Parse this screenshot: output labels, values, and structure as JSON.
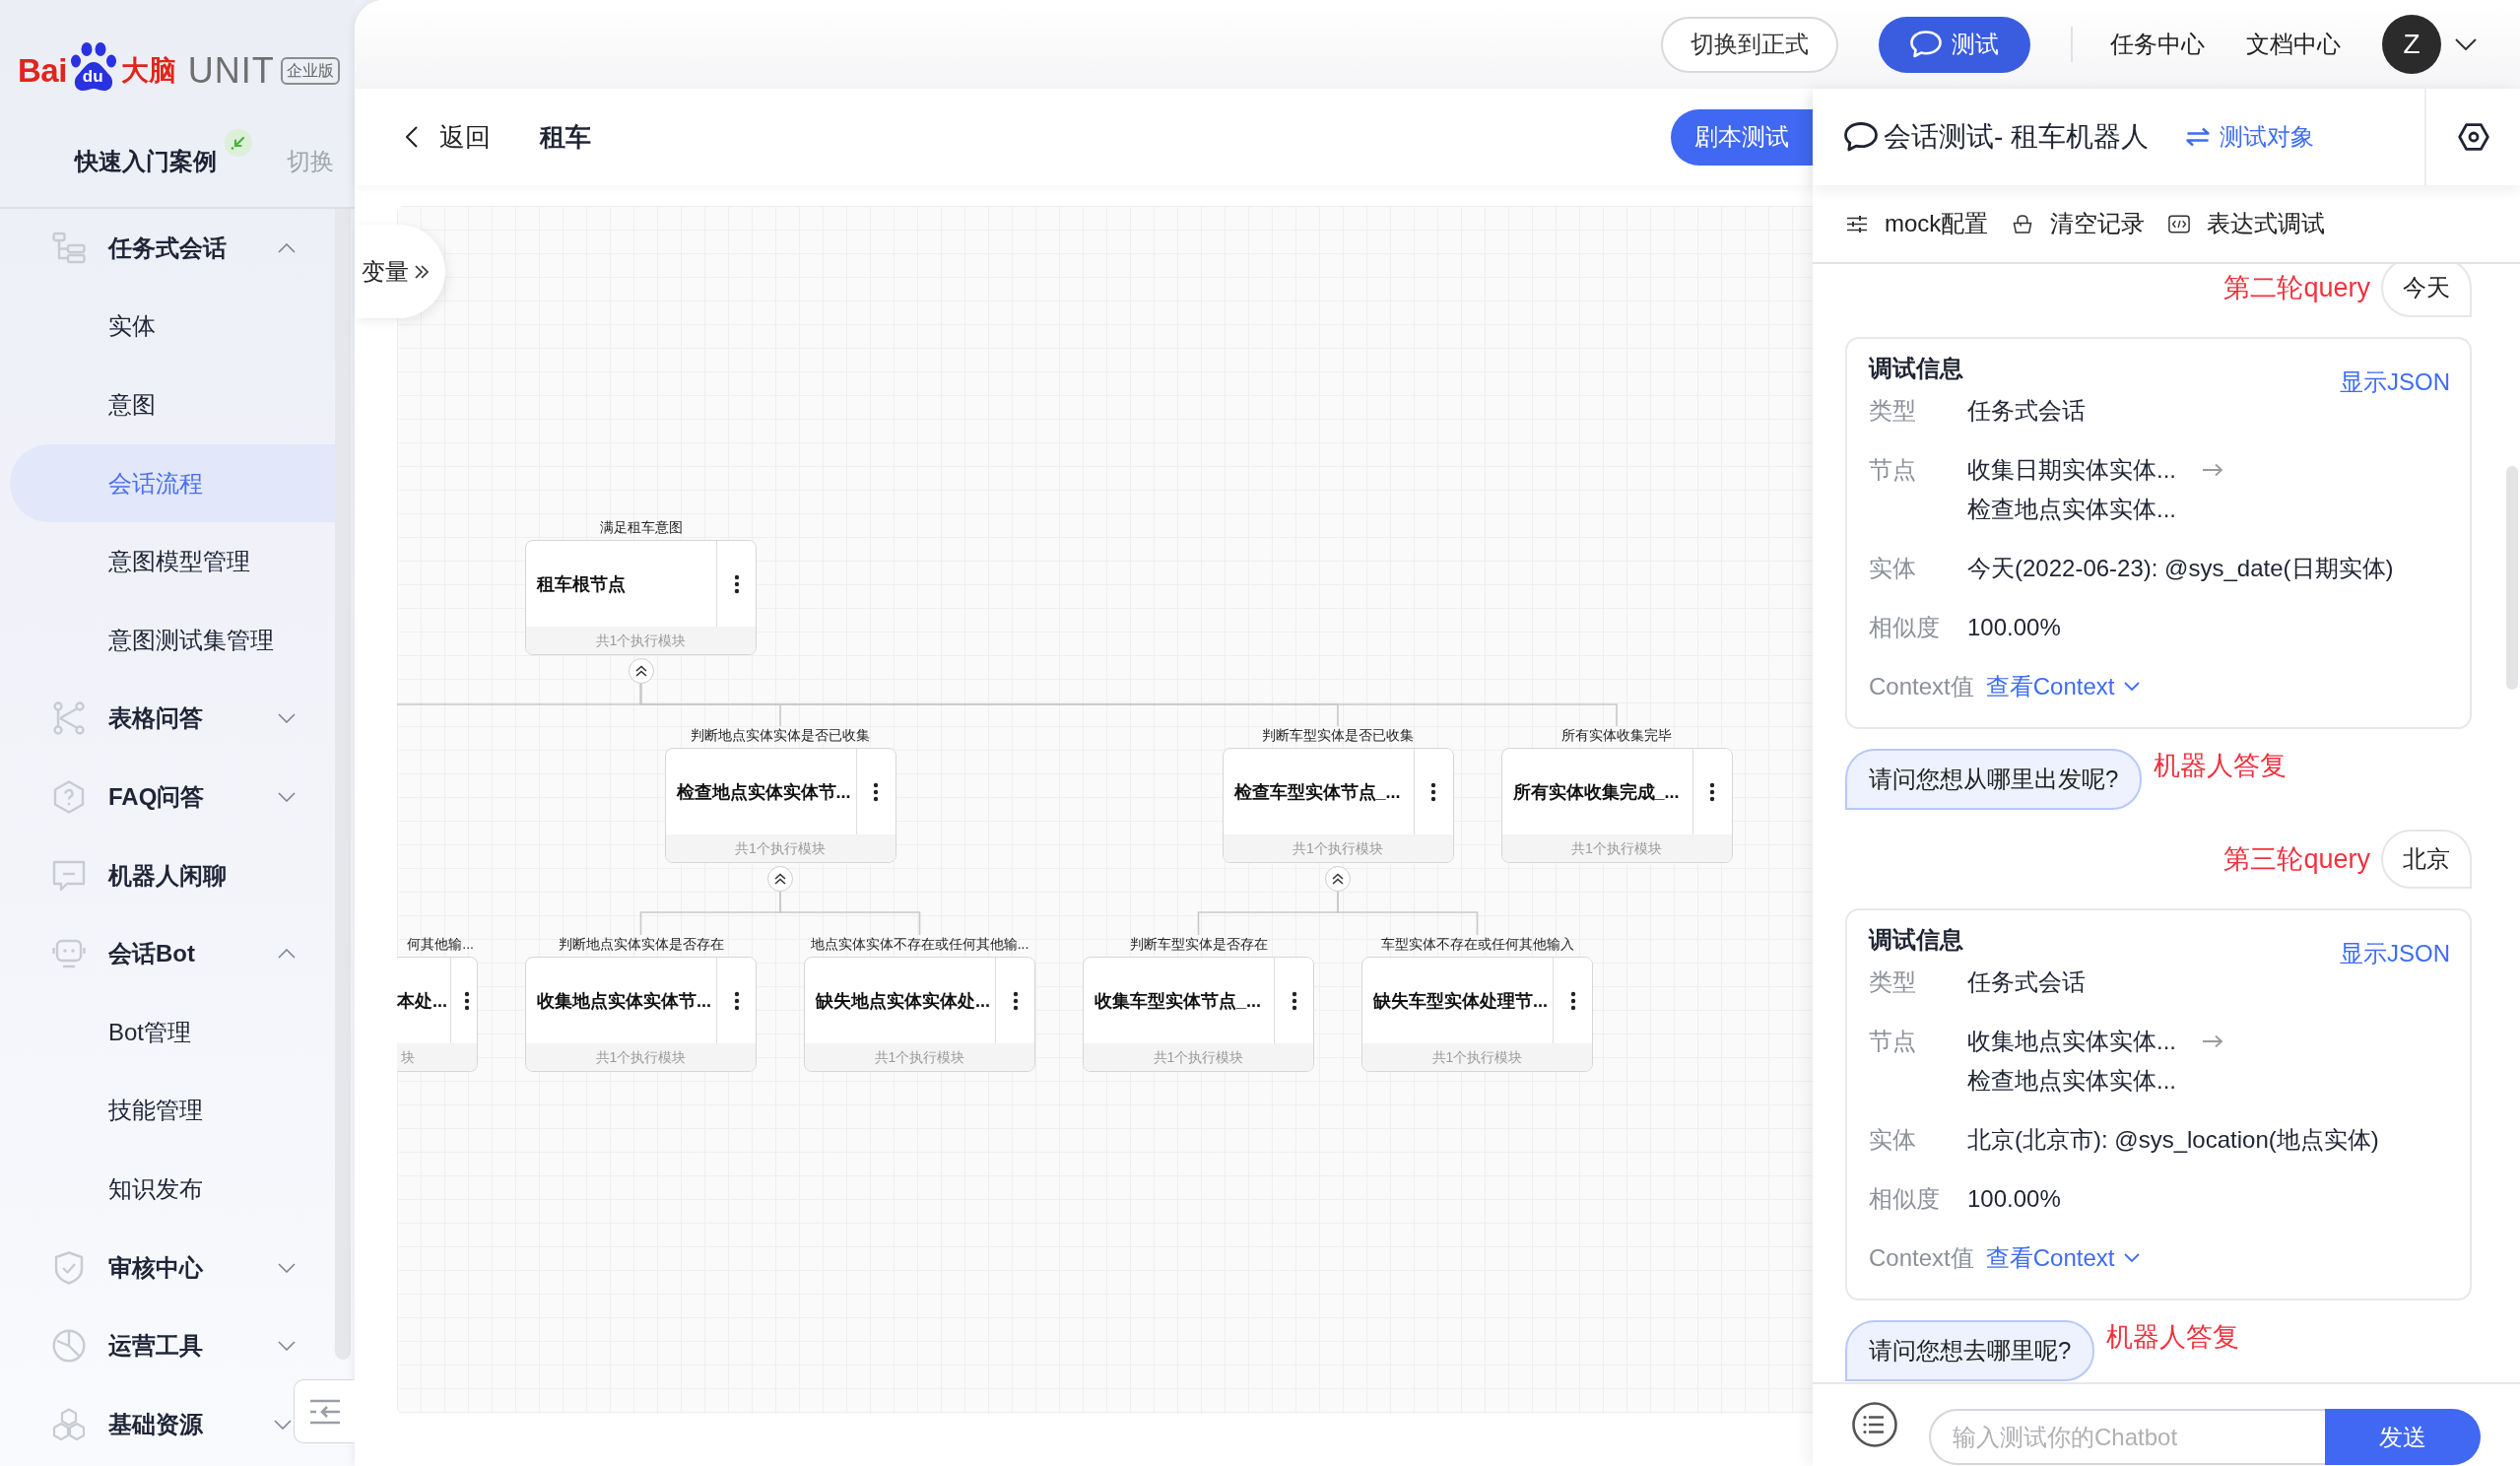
{
  "logo": {
    "brand": "Bai",
    "mark": "du",
    "product_cn": "大脑",
    "product": "UNIT",
    "edition": "企业版"
  },
  "project": {
    "name": "快速入门案例",
    "switch": "切换"
  },
  "sidebar": {
    "items": [
      {
        "label": "任务式会话",
        "expanded": true,
        "children": [
          {
            "label": "实体",
            "selected": false
          },
          {
            "label": "意图",
            "selected": false
          },
          {
            "label": "会话流程",
            "selected": true
          },
          {
            "label": "意图模型管理",
            "selected": false
          },
          {
            "label": "意图测试集管理",
            "selected": false
          }
        ]
      },
      {
        "label": "表格问答",
        "expanded": false
      },
      {
        "label": "FAQ问答",
        "expanded": false
      },
      {
        "label": "机器人闲聊",
        "selected": false
      },
      {
        "label": "会话Bot",
        "expanded": true,
        "children": [
          {
            "label": "Bot管理",
            "selected": false
          },
          {
            "label": "技能管理",
            "selected": false
          },
          {
            "label": "知识发布",
            "selected": false
          }
        ]
      },
      {
        "label": "审核中心",
        "expanded": false
      },
      {
        "label": "运营工具",
        "expanded": false
      },
      {
        "label": "基础资源",
        "expanded": false
      }
    ]
  },
  "topbar": {
    "buttons": [
      {
        "label": "切换到正式",
        "kind": "outline"
      },
      {
        "label": "测试",
        "kind": "primary"
      }
    ],
    "links": [
      "任务中心",
      "文档中心"
    ],
    "avatar": "Z"
  },
  "page": {
    "back": "返回",
    "title": "租车",
    "action": "剧本测试",
    "variables": "变量"
  },
  "flow": {
    "nodes": [
      {
        "condition": "满足租车意图",
        "title": "租车根节点",
        "footer": "共1个执行模块",
        "children": [
          {
            "condition": "判断地点实体实体是否已收集",
            "title": "检查地点实体实体节...",
            "footer": "共1个执行模块",
            "children": [
              {
                "condition": "判断地点实体实体是否存在",
                "title": "收集地点实体实体节...",
                "footer": "共1个执行模块"
              },
              {
                "condition": "地点实体实体不存在或任何其他输...",
                "title": "缺失地点实体实体处...",
                "footer": "共1个执行模块"
              }
            ]
          },
          {
            "condition": "判断车型实体是否已收集",
            "title": "检查车型实体节点_...",
            "footer": "共1个执行模块",
            "children": [
              {
                "condition": "判断车型实体是否存在",
                "title": "收集车型实体节点_...",
                "footer": "共1个执行模块"
              },
              {
                "condition": "车型实体不存在或任何其他输入",
                "title": "缺失车型实体处理节...",
                "footer": "共1个执行模块"
              }
            ]
          },
          {
            "condition": "所有实体收集完毕",
            "title": "所有实体收集完成_...",
            "footer": "共1个执行模块"
          }
        ]
      }
    ],
    "cut_nodes": [
      {
        "condition": "何其他输...",
        "title": "本处...",
        "footer": "块"
      }
    ]
  },
  "chat": {
    "title": "会话测试- 租车机器人",
    "target": "测试对象",
    "tools": [
      "mock配置",
      "清空记录",
      "表达式调试"
    ],
    "messages": [
      {
        "kind": "user",
        "text": "今天",
        "annotation": "第二轮query"
      },
      {
        "kind": "debug",
        "title": "调试信息",
        "json_link": "显示JSON",
        "rows": [
          {
            "label": "类型",
            "values": [
              "任务式会话"
            ]
          },
          {
            "label": "节点",
            "values": [
              "收集日期实体实体...",
              "检查地点实体实体..."
            ]
          },
          {
            "label": "实体",
            "values": [
              "今天(2022-06-23): @sys_date(日期实体)"
            ]
          },
          {
            "label": "相似度",
            "values": [
              "100.00%"
            ]
          }
        ],
        "context_label": "Context值",
        "context_link": "查看Context"
      },
      {
        "kind": "bot",
        "text": "请问您想从哪里出发呢?",
        "annotation": "机器人答复"
      },
      {
        "kind": "user",
        "text": "北京",
        "annotation": "第三轮query"
      },
      {
        "kind": "debug",
        "title": "调试信息",
        "json_link": "显示JSON",
        "rows": [
          {
            "label": "类型",
            "values": [
              "任务式会话"
            ]
          },
          {
            "label": "节点",
            "values": [
              "收集地点实体实体...",
              "检查地点实体实体..."
            ]
          },
          {
            "label": "实体",
            "values": [
              "北京(北京市): @sys_location(地点实体)"
            ]
          },
          {
            "label": "相似度",
            "values": [
              "100.00%"
            ]
          }
        ],
        "context_label": "Context值",
        "context_link": "查看Context"
      },
      {
        "kind": "bot",
        "text": "请问您想去哪里呢?",
        "annotation": "机器人答复"
      }
    ],
    "input": {
      "placeholder": "输入测试你的Chatbot"
    },
    "send": "发送"
  }
}
